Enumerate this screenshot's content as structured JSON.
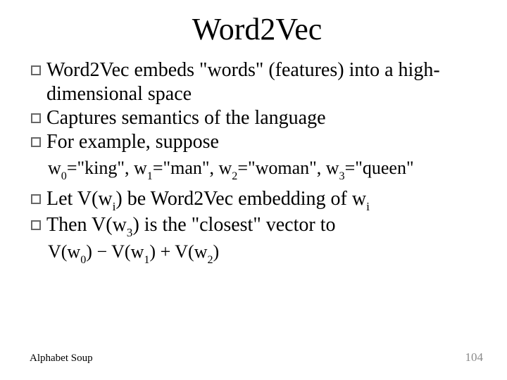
{
  "title": "Word2Vec",
  "bullets": {
    "b1": "Word2Vec embeds \"words\" (features) into a high-dimensional space",
    "b2": "Captures semantics of the language",
    "b3": "For example, suppose",
    "b4_pre": "Let V(w",
    "b4_mid": ") be Word2Vec embedding of w",
    "b5_pre": "Then V(w",
    "b5_mid": ") is the \"closest\" vector to"
  },
  "formula1": {
    "w0_lhs": "w",
    "w0_sub": "0",
    "w0_rhs": "=\"king\", ",
    "w1_lhs": "w",
    "w1_sub": "1",
    "w1_rhs": "=\"man\", ",
    "w2_lhs": "w",
    "w2_sub": "2",
    "w2_rhs": "=\"woman\", ",
    "w3_lhs": "w",
    "w3_sub": "3",
    "w3_rhs": "=\"queen\""
  },
  "sub_i": "i",
  "sub_3": "3",
  "formula2": {
    "p1": "V(w",
    "s0": "0",
    "p2": ") − V(w",
    "s1": "1",
    "p3": ") + V(w",
    "s2": "2",
    "p4": ")"
  },
  "footer": {
    "left": "Alphabet Soup",
    "right": "104"
  }
}
